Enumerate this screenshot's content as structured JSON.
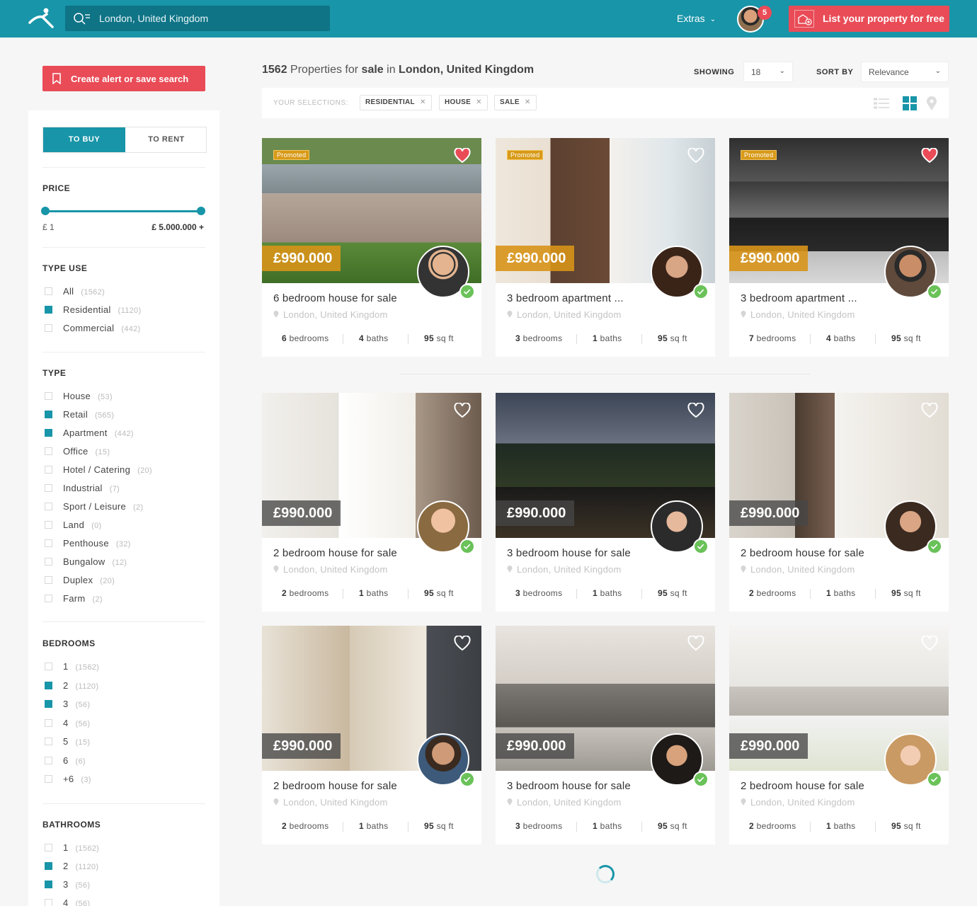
{
  "header": {
    "search_value": "London, United Kingdom",
    "extras_label": "Extras",
    "notification_count": "5",
    "list_property_label": "List your property for free"
  },
  "sidebar": {
    "alert_button": "Create alert or save search",
    "to_buy": "TO BUY",
    "to_rent": "TO RENT",
    "price": {
      "title": "PRICE",
      "min": "£ 1",
      "max": "£ 5.000.000 +"
    },
    "type_use": {
      "title": "TYPE USE",
      "options": [
        {
          "label": "All",
          "count": "(1562)",
          "checked": false
        },
        {
          "label": "Residential",
          "count": "(1120)",
          "checked": true
        },
        {
          "label": "Commercial",
          "count": "(442)",
          "checked": false
        }
      ]
    },
    "type": {
      "title": "TYPE",
      "options": [
        {
          "label": "House",
          "count": "(53)",
          "checked": false
        },
        {
          "label": "Retail",
          "count": "(565)",
          "checked": true
        },
        {
          "label": "Apartment",
          "count": "(442)",
          "checked": true
        },
        {
          "label": "Office",
          "count": "(15)",
          "checked": false
        },
        {
          "label": "Hotel / Catering",
          "count": "(20)",
          "checked": false
        },
        {
          "label": "Industrial",
          "count": "(7)",
          "checked": false
        },
        {
          "label": "Sport / Leisure",
          "count": "(2)",
          "checked": false
        },
        {
          "label": "Land",
          "count": "(0)",
          "checked": false
        },
        {
          "label": "Penthouse",
          "count": "(32)",
          "checked": false
        },
        {
          "label": "Bungalow",
          "count": "(12)",
          "checked": false
        },
        {
          "label": "Duplex",
          "count": "(20)",
          "checked": false
        },
        {
          "label": "Farm",
          "count": "(2)",
          "checked": false
        }
      ]
    },
    "bedrooms": {
      "title": "BEDROOMS",
      "options": [
        {
          "label": "1",
          "count": "(1562)",
          "checked": false
        },
        {
          "label": "2",
          "count": "(1120)",
          "checked": true
        },
        {
          "label": "3",
          "count": "(56)",
          "checked": true
        },
        {
          "label": "4",
          "count": "(56)",
          "checked": false
        },
        {
          "label": "5",
          "count": "(15)",
          "checked": false
        },
        {
          "label": "6",
          "count": "(6)",
          "checked": false
        },
        {
          "label": "+6",
          "count": "(3)",
          "checked": false
        }
      ]
    },
    "bathrooms": {
      "title": "BATHROOMS",
      "options": [
        {
          "label": "1",
          "count": "(1562)",
          "checked": false
        },
        {
          "label": "2",
          "count": "(1120)",
          "checked": true
        },
        {
          "label": "3",
          "count": "(56)",
          "checked": true
        },
        {
          "label": "4",
          "count": "(56)",
          "checked": false
        }
      ]
    }
  },
  "results": {
    "count": "1562",
    "text1": "Properties for",
    "mode": "sale",
    "text2": "in",
    "location": "London, United Kingdom",
    "showing_label": "SHOWING",
    "showing_value": "18",
    "sort_label": "SORT BY",
    "sort_value": "Relevance",
    "selections_label": "YOUR SELECTIONS:",
    "chips": [
      "RESIDENTIAL",
      "HOUSE",
      "SALE"
    ]
  },
  "cards": [
    {
      "price": "£990.000",
      "title": "6 bedroom house for sale",
      "location": "London, United Kingdom",
      "beds": "6",
      "beds_label": "bedrooms",
      "baths": "4",
      "baths_label": "baths",
      "area": "95",
      "area_label": "sq ft",
      "promoted": "Promoted",
      "favorite": true
    },
    {
      "price": "£990.000",
      "title": "3 bedroom apartment ...",
      "location": "London, United Kingdom",
      "beds": "3",
      "beds_label": "bedrooms",
      "baths": "1",
      "baths_label": "baths",
      "area": "95",
      "area_label": "sq ft",
      "promoted": "Promoted",
      "favorite": false
    },
    {
      "price": "£990.000",
      "title": "3 bedroom apartment ...",
      "location": "London, United Kingdom",
      "beds": "7",
      "beds_label": "bedrooms",
      "baths": "4",
      "baths_label": "baths",
      "area": "95",
      "area_label": "sq ft",
      "promoted": "Promoted",
      "favorite": true
    },
    {
      "price": "£990.000",
      "title": "2 bedroom house for sale",
      "location": "London, United Kingdom",
      "beds": "2",
      "beds_label": "bedrooms",
      "baths": "1",
      "baths_label": "baths",
      "area": "95",
      "area_label": "sq ft",
      "promoted": "",
      "favorite": false
    },
    {
      "price": "£990.000",
      "title": "3 bedroom house for sale",
      "location": "London, United Kingdom",
      "beds": "3",
      "beds_label": "bedrooms",
      "baths": "1",
      "baths_label": "baths",
      "area": "95",
      "area_label": "sq ft",
      "promoted": "",
      "favorite": false
    },
    {
      "price": "£990.000",
      "title": "2 bedroom house for sale",
      "location": "London, United Kingdom",
      "beds": "2",
      "beds_label": "bedrooms",
      "baths": "1",
      "baths_label": "baths",
      "area": "95",
      "area_label": "sq ft",
      "promoted": "",
      "favorite": false
    },
    {
      "price": "£990.000",
      "title": "2 bedroom house for sale",
      "location": "London, United Kingdom",
      "beds": "2",
      "beds_label": "bedrooms",
      "baths": "1",
      "baths_label": "baths",
      "area": "95",
      "area_label": "sq ft",
      "promoted": "",
      "favorite": false
    },
    {
      "price": "£990.000",
      "title": "3 bedroom house for sale",
      "location": "London, United Kingdom",
      "beds": "3",
      "beds_label": "bedrooms",
      "baths": "1",
      "baths_label": "baths",
      "area": "95",
      "area_label": "sq ft",
      "promoted": "",
      "favorite": false
    },
    {
      "price": "£990.000",
      "title": "2 bedroom house for sale",
      "location": "London, United Kingdom",
      "beds": "2",
      "beds_label": "bedrooms",
      "baths": "1",
      "baths_label": "baths",
      "area": "95",
      "area_label": "sq ft",
      "promoted": "",
      "favorite": false
    }
  ],
  "colors": {
    "brand": "#1895a8",
    "accent": "#e94c57",
    "promoted": "#d89a18",
    "verified": "#6ac259"
  }
}
